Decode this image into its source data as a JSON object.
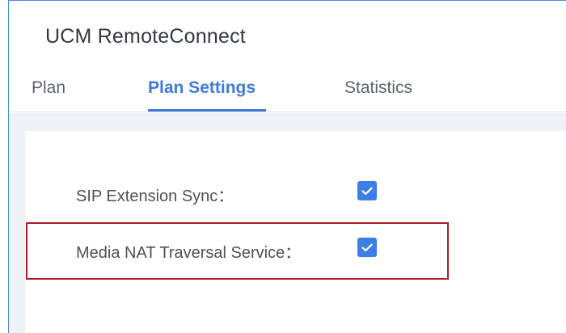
{
  "app": {
    "title": "UCM RemoteConnect"
  },
  "tabs": [
    {
      "label": "Plan",
      "active": false
    },
    {
      "label": "Plan Settings",
      "active": true
    },
    {
      "label": "Statistics",
      "active": false
    }
  ],
  "settings": {
    "sip_sync": {
      "label": "SIP Extension Sync：",
      "checked": true
    },
    "media_nat": {
      "label": "Media NAT Traversal Service：",
      "checked": true
    }
  },
  "colors": {
    "accent": "#3f7ad8",
    "checkbox": "#3a7ee6",
    "highlight": "#a81d22"
  }
}
